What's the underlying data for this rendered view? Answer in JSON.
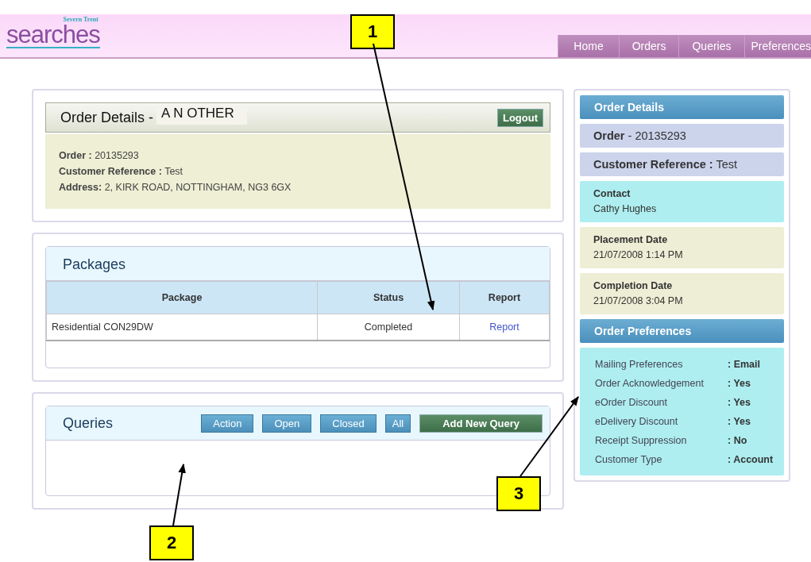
{
  "logo": {
    "brand": "Severn Trent",
    "name": "searches"
  },
  "nav": [
    {
      "label": "Home",
      "selected": false
    },
    {
      "label": "Orders",
      "selected": false
    },
    {
      "label": "Queries",
      "selected": false
    },
    {
      "label": "Preferences",
      "selected": false
    }
  ],
  "order_panel": {
    "title": "Order Details -",
    "customer": "A N OTHER",
    "logout": "Logout",
    "fields": [
      {
        "label": "Order :",
        "value": "20135293"
      },
      {
        "label": "Customer Reference :",
        "value": "Test"
      },
      {
        "label": "Address:",
        "value": "2, KIRK ROAD, NOTTINGHAM, NG3 6GX"
      }
    ]
  },
  "packages": {
    "title": "Packages",
    "columns": [
      "Package",
      "Status",
      "Report"
    ],
    "rows": [
      {
        "package": "Residential CON29DW",
        "status": "Completed",
        "report": "Report"
      }
    ]
  },
  "queries": {
    "title": "Queries",
    "filters": [
      {
        "label": "Action",
        "kind": "filter"
      },
      {
        "label": "Open",
        "kind": "filter"
      },
      {
        "label": "Closed",
        "kind": "filter"
      },
      {
        "label": "All",
        "kind": "filter"
      },
      {
        "label": "Add New Query",
        "kind": "add"
      }
    ]
  },
  "sidebar": {
    "title": "Order Details",
    "summary": [
      {
        "label": "Order",
        "value": "- 20135293"
      },
      {
        "label": "Customer Reference :",
        "value": "Test"
      }
    ],
    "details": [
      {
        "label": "Contact",
        "value": "Cathy Hughes",
        "color": "#aeeef0"
      },
      {
        "label": "Placement Date",
        "value": "21/07/2008 1:14 PM",
        "color": "#eeeed6"
      },
      {
        "label": "Completion Date",
        "value": "21/07/2008 3:04 PM",
        "color": "#eeeed6"
      }
    ],
    "preferences_title": "Order Preferences",
    "preferences": [
      {
        "label": "Mailing Preferences",
        "value": ": Email"
      },
      {
        "label": "Order Acknowledgement",
        "value": ": Yes"
      },
      {
        "label": "eOrder Discount",
        "value": ": Yes"
      },
      {
        "label": "eDelivery Discount",
        "value": ": Yes"
      },
      {
        "label": "Receipt Suppression",
        "value": ": No"
      },
      {
        "label": "Customer Type",
        "value": ": Account"
      }
    ]
  },
  "callouts": [
    {
      "label": "1"
    },
    {
      "label": "2"
    },
    {
      "label": "3"
    }
  ]
}
